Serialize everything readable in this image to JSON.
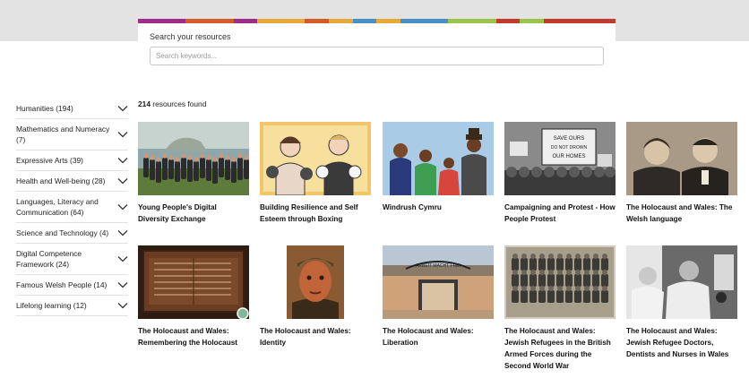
{
  "search": {
    "label": "Search your resources",
    "placeholder": "Search keywords..."
  },
  "stripe_colors": [
    "#9b2d8c",
    "#9b2d8c",
    "#d55a2a",
    "#d55a2a",
    "#9b2d8c",
    "#e9a93a",
    "#e9a93a",
    "#d55a2a",
    "#e9a93a",
    "#4a90c8",
    "#e9a93a",
    "#4a90c8",
    "#4a90c8",
    "#9bc44a",
    "#9bc44a",
    "#c43a2e",
    "#9bc44a",
    "#c43a2e",
    "#c43a2e",
    "#c43a2e"
  ],
  "sidebar": {
    "items": [
      {
        "label": "Humanities (194)"
      },
      {
        "label": "Mathematics and Numeracy (7)"
      },
      {
        "label": "Expressive Arts (39)"
      },
      {
        "label": "Health and Well-being (28)"
      },
      {
        "label": "Languages, Literacy and Communication (64)"
      },
      {
        "label": "Science and Technology (4)"
      },
      {
        "label": "Digital Competence Framework (24)"
      },
      {
        "label": "Famous Welsh People (14)"
      },
      {
        "label": "Lifelong learning (12)"
      }
    ]
  },
  "results": {
    "count": "214",
    "suffix": " resources found"
  },
  "cards": [
    {
      "title": "Young People's Digital Diversity Exchange",
      "icon": "group-photo"
    },
    {
      "title": "Building Resilience and Self Esteem through Boxing",
      "icon": "boxing-illustration"
    },
    {
      "title": "Windrush Cymru",
      "icon": "family-illustration"
    },
    {
      "title": "Campaigning and Protest - How People Protest",
      "icon": "protest-photo"
    },
    {
      "title": "The Holocaust and Wales: The Welsh language",
      "icon": "couple-portrait"
    },
    {
      "title": "The Holocaust and Wales: Remembering the Holocaust",
      "icon": "memorial-board"
    },
    {
      "title": "The Holocaust and Wales: Identity",
      "icon": "portrait-painting"
    },
    {
      "title": "The Holocaust and Wales: Liberation",
      "icon": "camp-gate"
    },
    {
      "title": "The Holocaust and Wales: Jewish Refugees in the British Armed Forces during the Second World War",
      "icon": "soldiers-group"
    },
    {
      "title": "The Holocaust and Wales: Jewish Refugee Doctors, Dentists and Nurses in Wales",
      "icon": "doctor-photo"
    }
  ]
}
